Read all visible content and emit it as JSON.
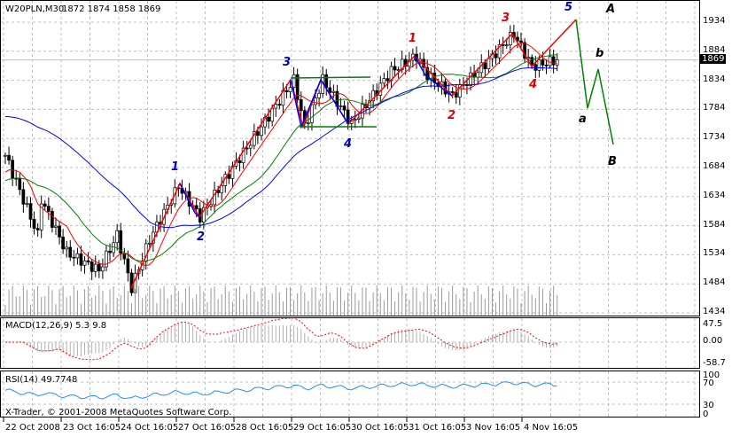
{
  "header": {
    "symbol": "W20PLN,M30",
    "ohlc": "1872 1874 1858 1869"
  },
  "price_axis": {
    "ticks": [
      "1934",
      "1884",
      "1834",
      "1784",
      "1734",
      "1684",
      "1634",
      "1584",
      "1534",
      "1484",
      "1434"
    ],
    "current": "1869"
  },
  "macd": {
    "label": "MACD(12,26,9) 5.3 9.8",
    "ticks": [
      "47.5",
      "0.00",
      "-58.7"
    ]
  },
  "rsi": {
    "label": "RSI(14) 49.7748",
    "ticks": [
      "100",
      "70",
      "30",
      "0"
    ]
  },
  "copyright": "X-Trader, © 2001-2008 MetaQuotes Software Corp.",
  "time_axis": [
    "22 Oct 2008",
    "23 Oct 16:05",
    "24 Oct 16:05",
    "27 Oct 16:05",
    "28 Oct 16:05",
    "29 Oct 16:05",
    "30 Oct 16:05",
    "31 Oct 16:05",
    "3 Nov 16:05",
    "4 Nov 16:05"
  ],
  "wave_labels": {
    "blue1": "1",
    "blue2": "2",
    "blue3": "3",
    "blue4": "4",
    "blue5": "5",
    "red1": "1",
    "red2": "2",
    "red3": "3",
    "red4": "4",
    "A": "A",
    "a": "a",
    "b": "b",
    "B": "B"
  },
  "colors": {
    "bull": "#000000",
    "ma_fast": "#ff0000",
    "ma_mid": "#008000",
    "ma_slow": "#0000ff",
    "rsi": "#1e90ff",
    "macd_signal": "#ff0000",
    "wave_red": "#ff0000",
    "wave_blue": "#0000ff",
    "wave_green": "#008000"
  },
  "chart_data": {
    "type": "candlestick",
    "price_range": [
      1434,
      1934
    ],
    "anchors": [
      [
        0,
        1705
      ],
      [
        9,
        1568
      ],
      [
        10,
        1629
      ],
      [
        17,
        1538
      ],
      [
        26,
        1507
      ],
      [
        31,
        1568
      ],
      [
        35,
        1477
      ],
      [
        40,
        1561
      ],
      [
        48,
        1652
      ],
      [
        54,
        1599
      ],
      [
        63,
        1683
      ],
      [
        80,
        1835
      ],
      [
        83,
        1754
      ],
      [
        88,
        1835
      ],
      [
        96,
        1759
      ],
      [
        107,
        1850
      ],
      [
        114,
        1876
      ],
      [
        117,
        1843
      ],
      [
        124,
        1808
      ],
      [
        133,
        1862
      ],
      [
        141,
        1914
      ],
      [
        146,
        1858
      ],
      [
        153,
        1869
      ]
    ]
  }
}
